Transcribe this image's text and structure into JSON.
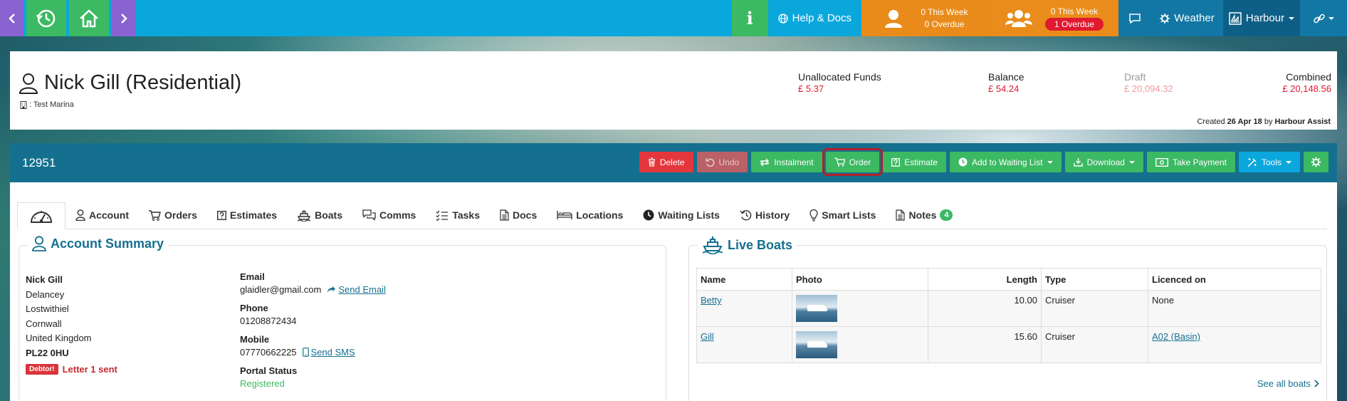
{
  "topbar": {
    "help_label": "Help & Docs",
    "my_tasks": {
      "this_week": "0 This Week",
      "overdue": "0 Overdue"
    },
    "team_tasks": {
      "this_week": "0 This Week",
      "overdue": "1 Overdue"
    },
    "weather_label": "Weather",
    "harbour_label": "Harbour"
  },
  "account": {
    "name": "Nick Gill (Residential)",
    "marina": ": Test Marina",
    "unallocated_label": "Unallocated Funds",
    "unallocated_value": "£ 5.37",
    "balance_label": "Balance",
    "balance_value": "£ 54.24",
    "draft_label": "Draft",
    "draft_value": "£ 20,094.32",
    "combined_label": "Combined",
    "combined_value": "£ 20,148.56",
    "created_prefix": "Created",
    "created_date": "26 Apr 18",
    "created_by_prefix": "by",
    "created_by": "Harbour Assist"
  },
  "record": {
    "id": "12951",
    "actions": {
      "delete": "Delete",
      "undo": "Undo",
      "instalment": "Instalment",
      "order": "Order",
      "estimate": "Estimate",
      "waiting_list": "Add to Waiting List",
      "download": "Download",
      "take_payment": "Take Payment",
      "tools": "Tools"
    }
  },
  "tabs": {
    "account": "Account",
    "orders": "Orders",
    "estimates": "Estimates",
    "boats": "Boats",
    "comms": "Comms",
    "tasks": "Tasks",
    "docs": "Docs",
    "locations": "Locations",
    "waiting_lists": "Waiting Lists",
    "history": "History",
    "smart_lists": "Smart Lists",
    "notes": "Notes",
    "notes_count": "4"
  },
  "summary": {
    "title": "Account Summary",
    "address": [
      "Nick Gill",
      "Delancey",
      "Lostwithiel",
      "Cornwall",
      "United Kingdom",
      "PL22 0HU"
    ],
    "debtor_tag": "Debtor!",
    "debtor_text": "Letter 1 sent",
    "email_label": "Email",
    "email_value": "glaidler@gmail.com",
    "send_email": "Send Email",
    "phone_label": "Phone",
    "phone_value": "01208872434",
    "mobile_label": "Mobile",
    "mobile_value": "07770662225",
    "send_sms": "Send SMS",
    "portal_label": "Portal Status",
    "portal_value": "Registered"
  },
  "boats": {
    "title": "Live Boats",
    "columns": {
      "name": "Name",
      "photo": "Photo",
      "length": "Length",
      "type": "Type",
      "licenced": "Licenced on"
    },
    "rows": [
      {
        "name": "Betty",
        "length": "10.00",
        "type": "Cruiser",
        "licenced": "None"
      },
      {
        "name": "Gill",
        "length": "15.60",
        "type": "Cruiser",
        "licenced": "A02 (Basin)"
      }
    ],
    "see_all": "See all boats"
  }
}
